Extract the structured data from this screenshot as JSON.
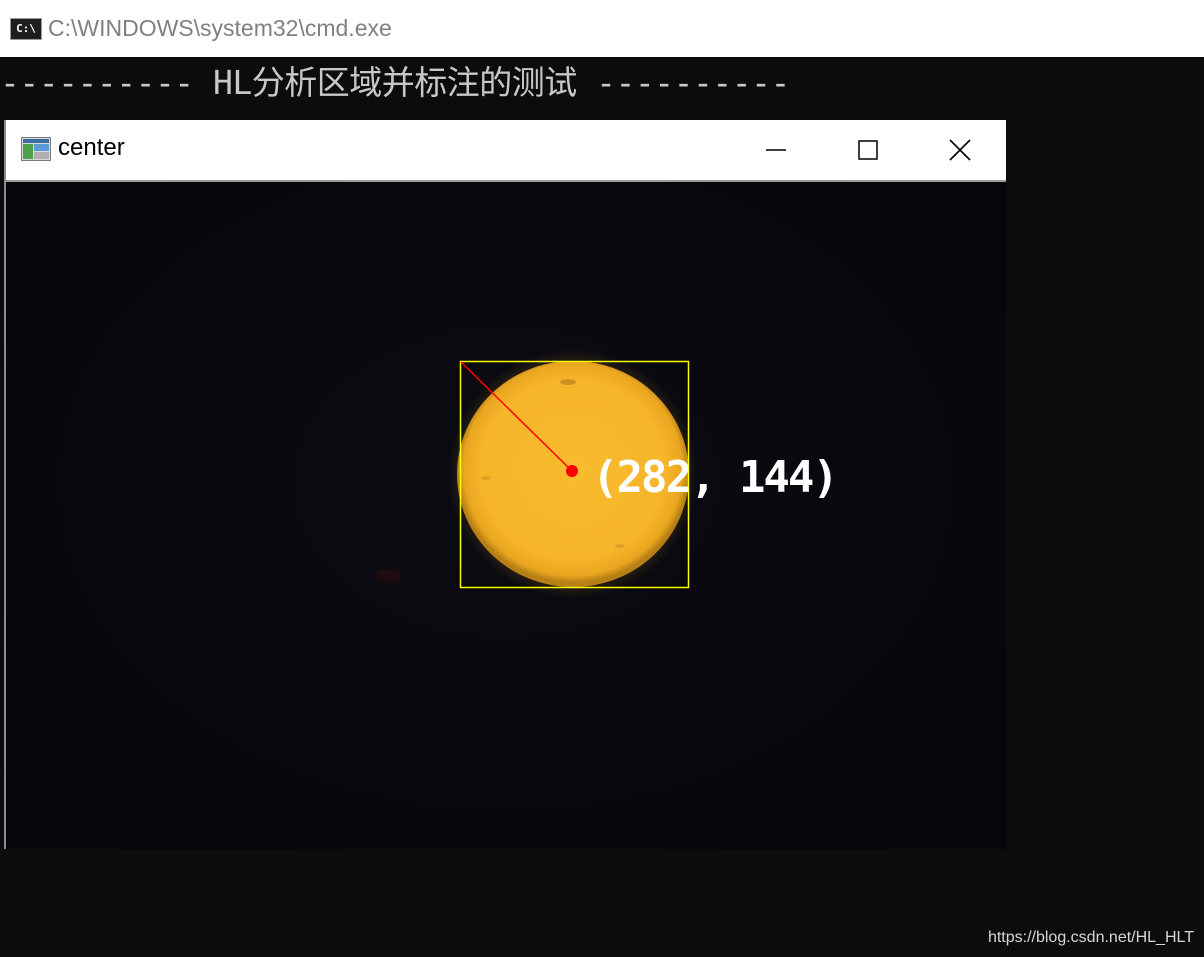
{
  "console_window": {
    "title": "C:\\WINDOWS\\system32\\cmd.exe",
    "icon": "console-icon",
    "icon_text": "C:\\",
    "output_line": "---------- HL分析区域并标注的测试 ----------"
  },
  "image_window": {
    "title": "center",
    "icon": "app-window-icon",
    "buttons": {
      "minimize": "minimize-icon",
      "maximize": "maximize-icon",
      "close": "close-icon"
    },
    "annotation": {
      "center_label": "(282, 144)",
      "box_color": "#ffff00",
      "line_color": "#ff0000",
      "center_dot_color": "#ff0000",
      "object_color": "#f7b52c"
    }
  },
  "watermark": "https://blog.csdn.net/HL_HLT"
}
